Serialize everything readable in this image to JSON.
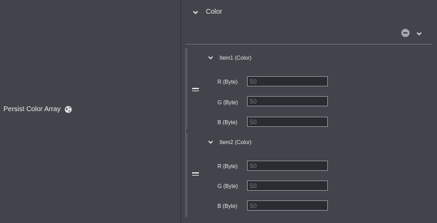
{
  "left": {
    "persist_label": "Persist Color Array"
  },
  "color_section": {
    "title": "Color"
  },
  "items": [
    {
      "title": "Item1 (Color)",
      "fields": [
        {
          "label": "R (Byte)",
          "placeholder": "50"
        },
        {
          "label": "G (Byte)",
          "placeholder": "50"
        },
        {
          "label": "B (Byte)",
          "placeholder": "50"
        }
      ]
    },
    {
      "title": "Item2 (Color)",
      "fields": [
        {
          "label": "R (Byte)",
          "placeholder": "50"
        },
        {
          "label": "G (Byte)",
          "placeholder": "50"
        },
        {
          "label": "B (Byte)",
          "placeholder": "50"
        }
      ]
    }
  ],
  "icons": {
    "globe": "globe-icon",
    "collapse": "chevron-down-icon",
    "remove": "minus-circle-icon",
    "menu": "chevron-down-icon",
    "drag": "drag-handle-icon"
  },
  "colors": {
    "background": "#42444c",
    "input_bg": "#2b2c31",
    "divider": "#6a6c74"
  }
}
